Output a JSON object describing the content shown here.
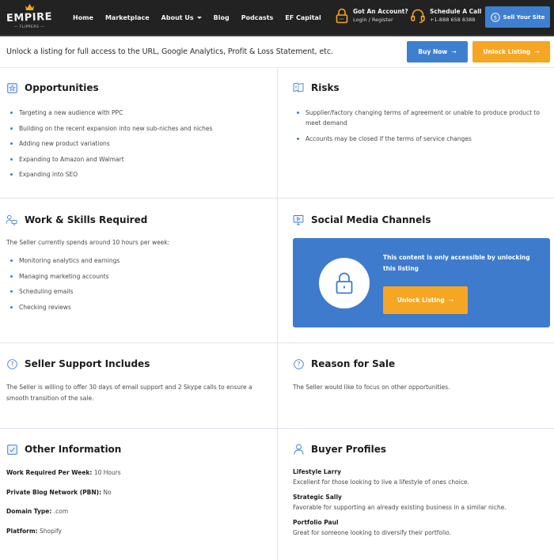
{
  "header": {
    "logo": {
      "word": "EMPIRE",
      "sub": "— FLIPPERS —"
    },
    "nav": [
      {
        "label": "Home",
        "has_dropdown": false
      },
      {
        "label": "Marketplace",
        "has_dropdown": false
      },
      {
        "label": "About Us",
        "has_dropdown": true
      },
      {
        "label": "Blog",
        "has_dropdown": false
      },
      {
        "label": "Podcasts",
        "has_dropdown": false
      },
      {
        "label": "EF Capital",
        "has_dropdown": false
      }
    ],
    "account": {
      "title": "Got An Account?",
      "subtitle": "Login / Register",
      "icon": "lock-icon"
    },
    "call": {
      "title": "Schedule A Call",
      "phone": "+1-888 658 8388",
      "icon": "headset-icon"
    },
    "sell_button": {
      "label": "Sell Your Site",
      "icon": "dollar-circle-icon"
    },
    "colors": {
      "bar": "#222222",
      "accent_orange": "#f5a623",
      "accent_blue": "#3f7fd0"
    }
  },
  "unlock_bar": {
    "message": "Unlock a listing for full access to the URL, Google Analytics, Profit & Loss Statement, etc.",
    "buy_now_label": "Buy Now",
    "unlock_label": "Unlock Listing",
    "arrow": "→"
  },
  "sections": {
    "opportunities": {
      "title": "Opportunities",
      "icon": "star-box-icon",
      "items": [
        "Targeting a new audience with PPC",
        "Building on the recent expansion into new sub-niches and niches",
        "Adding new product variations",
        "Expanding to Amazon and Walmart",
        "Expanding into SEO"
      ]
    },
    "risks": {
      "title": "Risks",
      "icon": "flag-alert-icon",
      "items": [
        "Supplier/factory changing terms of agreement or unable to produce product to meet demand",
        "Accounts may be closed if the terms of service changes"
      ]
    },
    "work": {
      "title": "Work & Skills Required",
      "icon": "person-monitor-icon",
      "intro": "The Seller currently spends around 10 hours per week:",
      "items": [
        "Monitoring analytics and earnings",
        "Managing marketing accounts",
        "Scheduling emails",
        "Checking reviews"
      ]
    },
    "social": {
      "title": "Social Media Channels",
      "icon": "monitor-play-icon",
      "locked_message": "This content is only accessible by unlocking this listing",
      "unlock_label": "Unlock Listing",
      "arrow": "→",
      "box_color": "#3f7bcc"
    },
    "support": {
      "title": "Seller Support Includes",
      "icon": "question-circle-icon",
      "text": "The Seller is willing to offer 30 days of email support and 2 Skype calls to ensure a smooth transition of the sale."
    },
    "reason": {
      "title": "Reason for Sale",
      "icon": "question-circle-icon",
      "text": "The Seller would like to focus on other opportunities."
    },
    "other": {
      "title": "Other Information",
      "icon": "checkbox-icon",
      "rows": [
        {
          "label": "Work Required Per Week:",
          "value": "10 Hours"
        },
        {
          "label": "Private Blog Network (PBN):",
          "value": "No"
        },
        {
          "label": "Domain Type:",
          "value": ".com"
        },
        {
          "label": "Platform:",
          "value": "Shopify"
        }
      ]
    },
    "buyers": {
      "title": "Buyer Profiles",
      "icon": "person-icon",
      "profiles": [
        {
          "name": "Lifestyle Larry",
          "desc": "Excellent for those looking to live a lifestyle of ones choice."
        },
        {
          "name": "Strategic Sally",
          "desc": "Favorable for supporting an already existing business in a similar niche."
        },
        {
          "name": "Portfolio Paul",
          "desc": "Great for someone looking to diversify their portfolio."
        }
      ]
    }
  }
}
